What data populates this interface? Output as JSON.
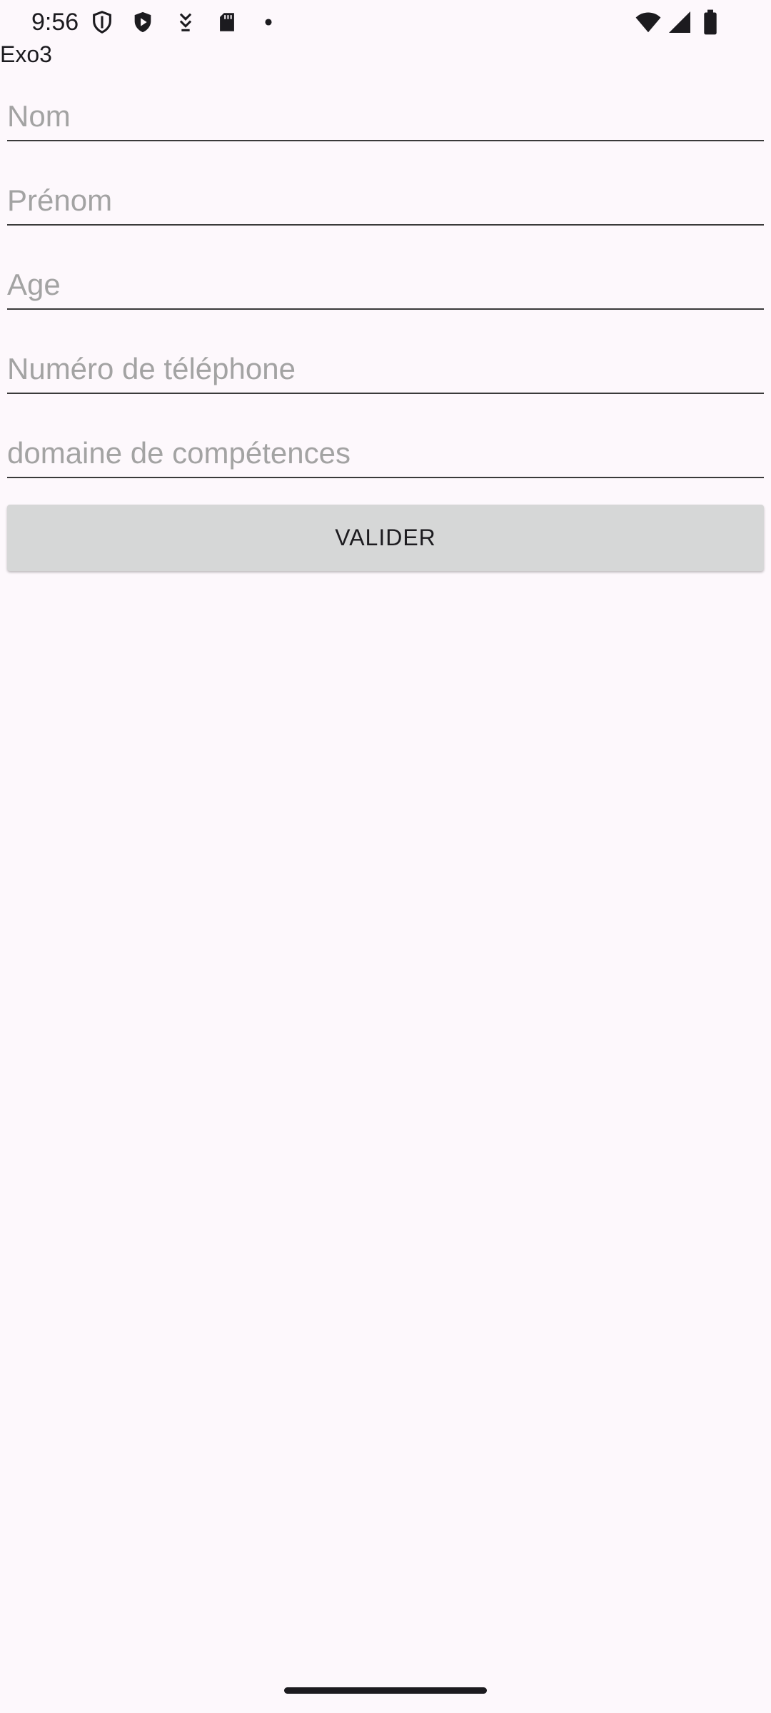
{
  "status_bar": {
    "time": "9:56",
    "left_icons": [
      "shield-outline-icon",
      "shield-play-icon",
      "download-arrows-icon",
      "sd-card-icon",
      "dot-icon"
    ],
    "right_icons": [
      "wifi-icon",
      "signal-icon",
      "battery-icon"
    ]
  },
  "app": {
    "title": "Exo3"
  },
  "form": {
    "nom_placeholder": "Nom",
    "prenom_placeholder": "Prénom",
    "age_placeholder": "Age",
    "telephone_placeholder": "Numéro de téléphone",
    "domaine_placeholder": "domaine de compétences",
    "nom_value": "",
    "prenom_value": "",
    "age_value": "",
    "telephone_value": "",
    "domaine_value": "",
    "submit_label": "VALIDER"
  },
  "colors": {
    "background": "#fdf8fc",
    "text": "#1c1b1f",
    "placeholder": "#a3a3a3",
    "button": "#d6d7d7"
  }
}
